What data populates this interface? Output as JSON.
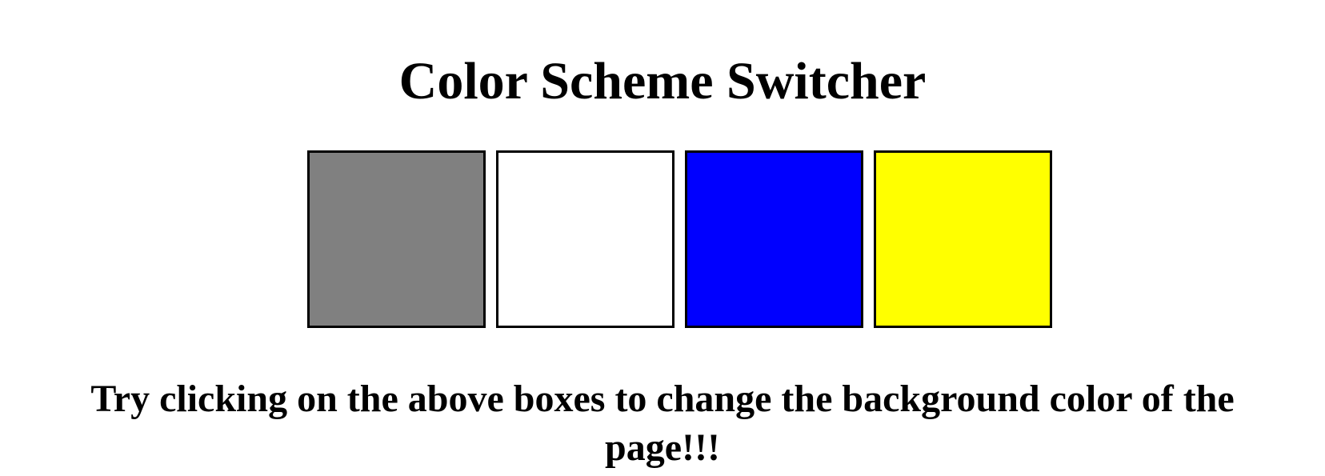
{
  "page": {
    "title": "Color Scheme Switcher",
    "instructions": "Try clicking on the above boxes to change the background color of the page!!!"
  },
  "swatches": [
    {
      "name": "grey",
      "color": "#808080"
    },
    {
      "name": "white",
      "color": "#ffffff"
    },
    {
      "name": "blue",
      "color": "#0000ff"
    },
    {
      "name": "yellow",
      "color": "#ffff00"
    }
  ]
}
